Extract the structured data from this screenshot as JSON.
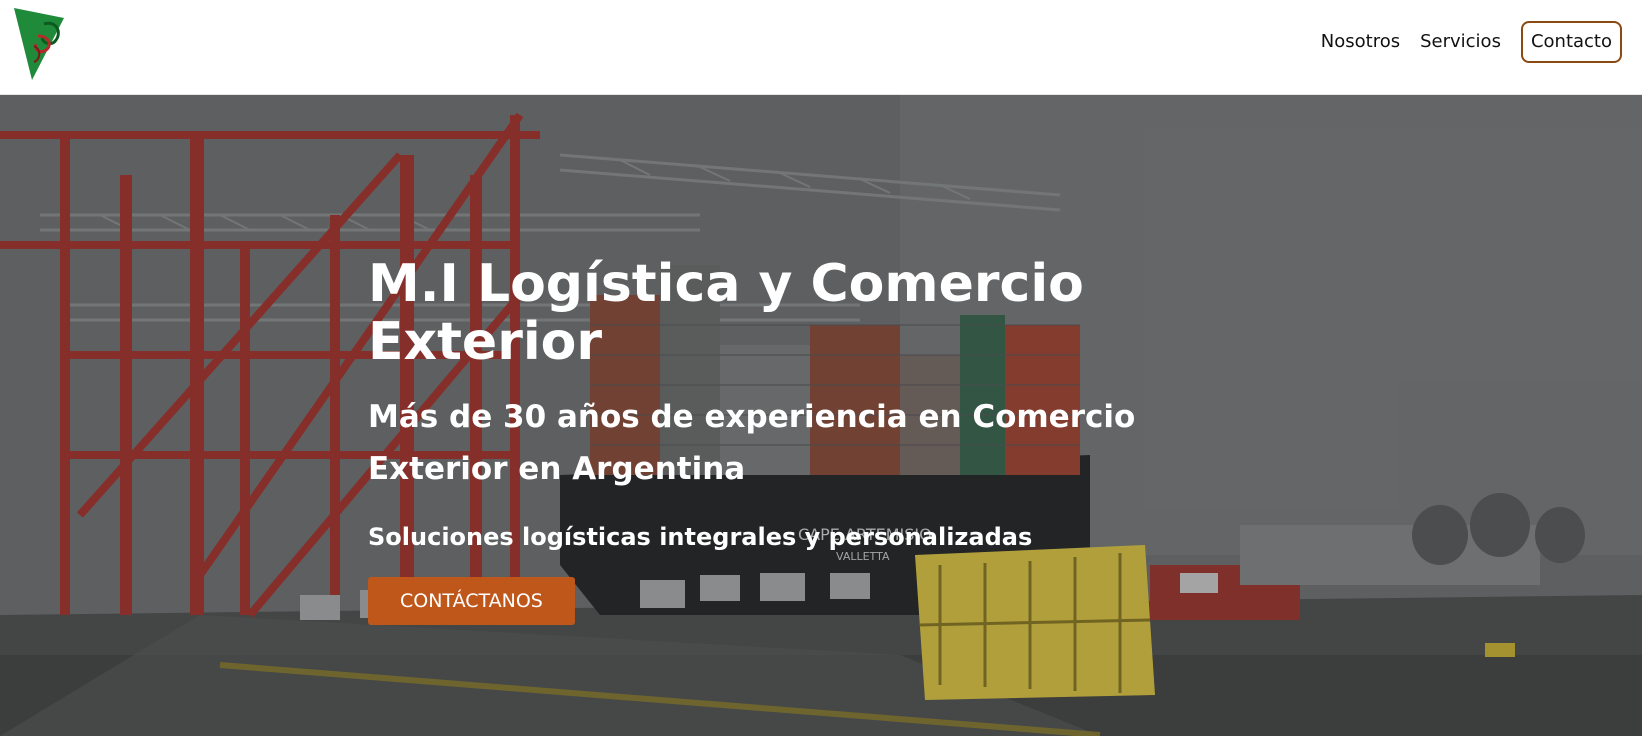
{
  "nav": {
    "items": [
      {
        "label": "Nosotros"
      },
      {
        "label": "Servicios"
      },
      {
        "label": "Contacto"
      }
    ]
  },
  "hero": {
    "title": "M.I Logística y Comercio Exterior",
    "subtitle": "Más de 30 años de experiencia en Comercio Exterior en Argentina",
    "tagline": "Soluciones logísticas integrales y personalizadas",
    "cta_label": "CONTÁCTANOS",
    "ship_name": "CAPE ARTEMISIO",
    "ship_port": "VALLETTA"
  },
  "colors": {
    "accent": "#c0571a",
    "contact_border": "#8a4a12",
    "logo_green": "#1f8a3a",
    "logo_red": "#b62a2a",
    "crane_red": "#a43a34",
    "platform_yellow": "#d8c24a"
  },
  "icons": {
    "logo": "triangle-logo-icon"
  }
}
